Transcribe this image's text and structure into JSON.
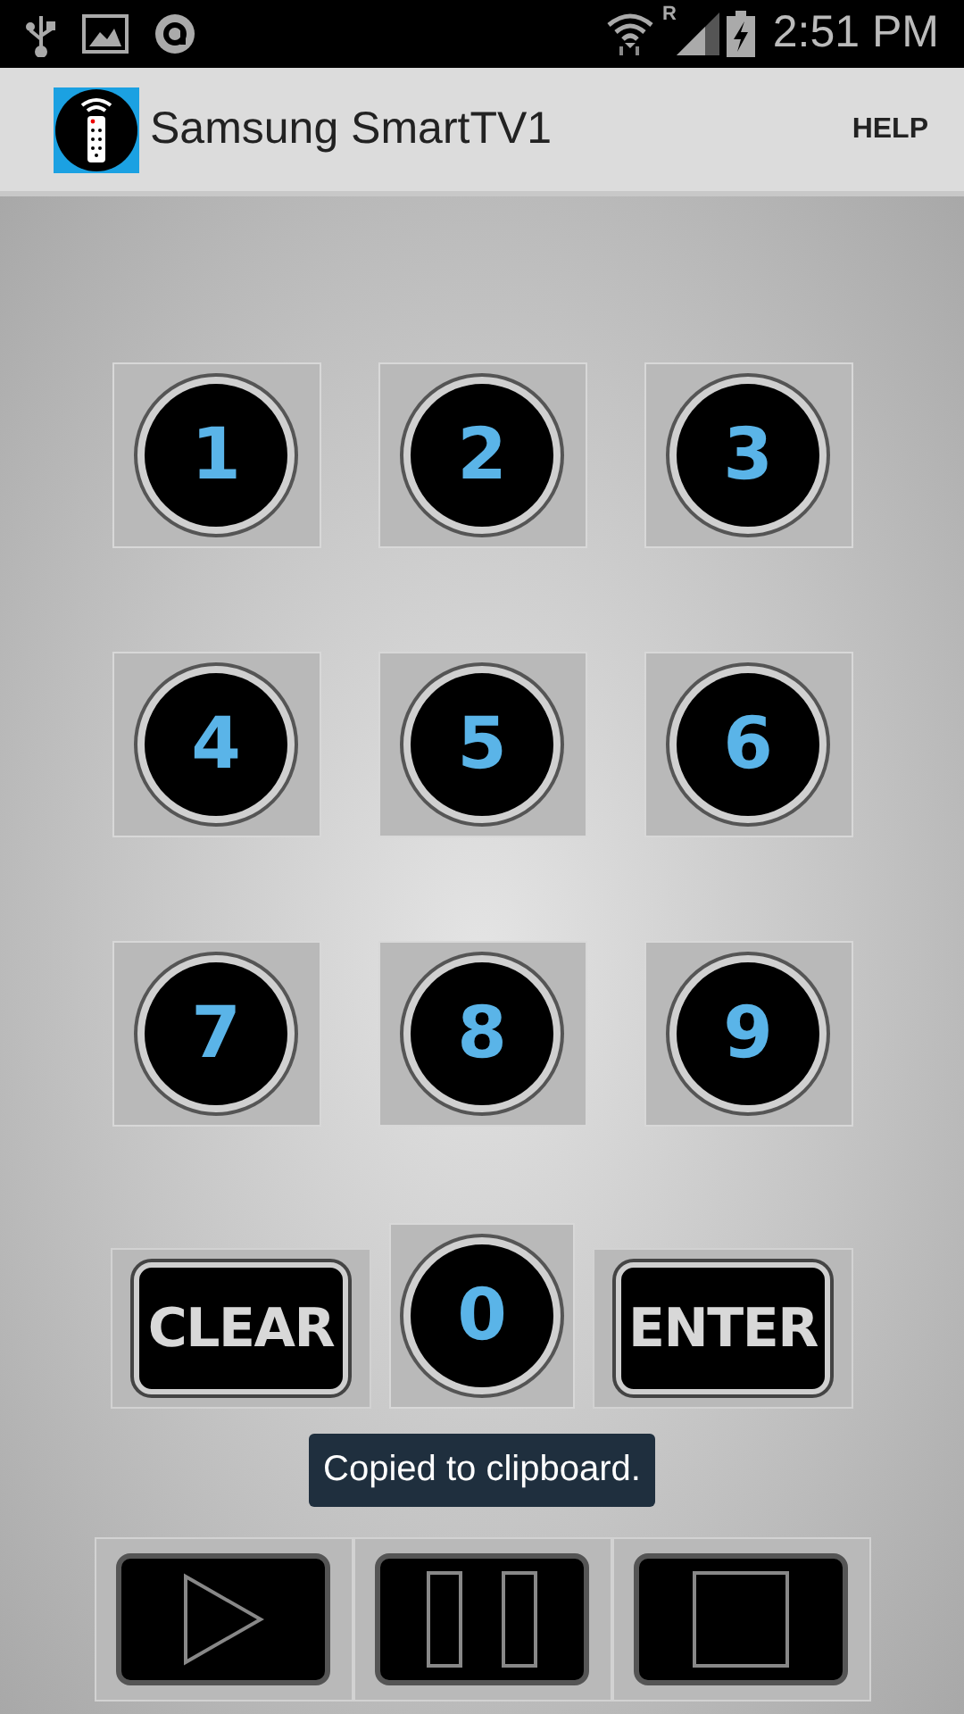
{
  "status_bar": {
    "network_label": "R",
    "time": "2:51 PM"
  },
  "app_bar": {
    "title": "Samsung SmartTV1",
    "action": "HELP"
  },
  "keypad": [
    {
      "label": "1"
    },
    {
      "label": "2"
    },
    {
      "label": "3"
    },
    {
      "label": "4"
    },
    {
      "label": "5"
    },
    {
      "label": "6"
    },
    {
      "label": "7"
    },
    {
      "label": "8"
    },
    {
      "label": "9"
    }
  ],
  "bottom_keys": [
    {
      "kind": "text",
      "label": "CLEAR"
    },
    {
      "kind": "digit",
      "label": "0"
    },
    {
      "kind": "text",
      "label": "ENTER"
    }
  ],
  "toast": "Copied to clipboard.",
  "transport": [
    {
      "kind": "play"
    },
    {
      "kind": "pause"
    },
    {
      "kind": "stop"
    }
  ]
}
